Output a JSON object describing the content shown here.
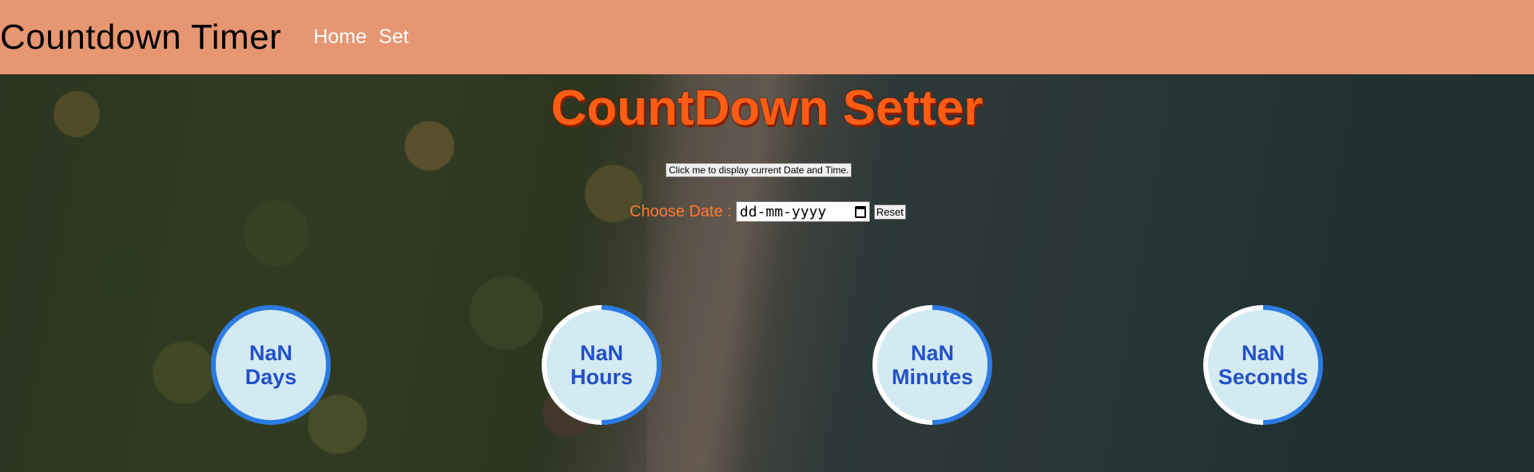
{
  "navbar": {
    "brand": "Countdown Timer",
    "links": [
      {
        "label": "Home"
      },
      {
        "label": "Set"
      }
    ],
    "color": "#e79672"
  },
  "main": {
    "title": "CountDown Setter",
    "show_datetime_button": "Click me to display current Date and Time.",
    "date_label": "Choose Date :",
    "date_placeholder": "dd-mm-yyyy",
    "reset_button": "Reset",
    "accent_color": "#ff5d14"
  },
  "timers": [
    {
      "value": "NaN",
      "unit": "Days"
    },
    {
      "value": "NaN",
      "unit": "Hours"
    },
    {
      "value": "NaN",
      "unit": "Minutes"
    },
    {
      "value": "NaN",
      "unit": "Seconds"
    }
  ],
  "icons": {
    "date_picker": "calendar-icon"
  }
}
